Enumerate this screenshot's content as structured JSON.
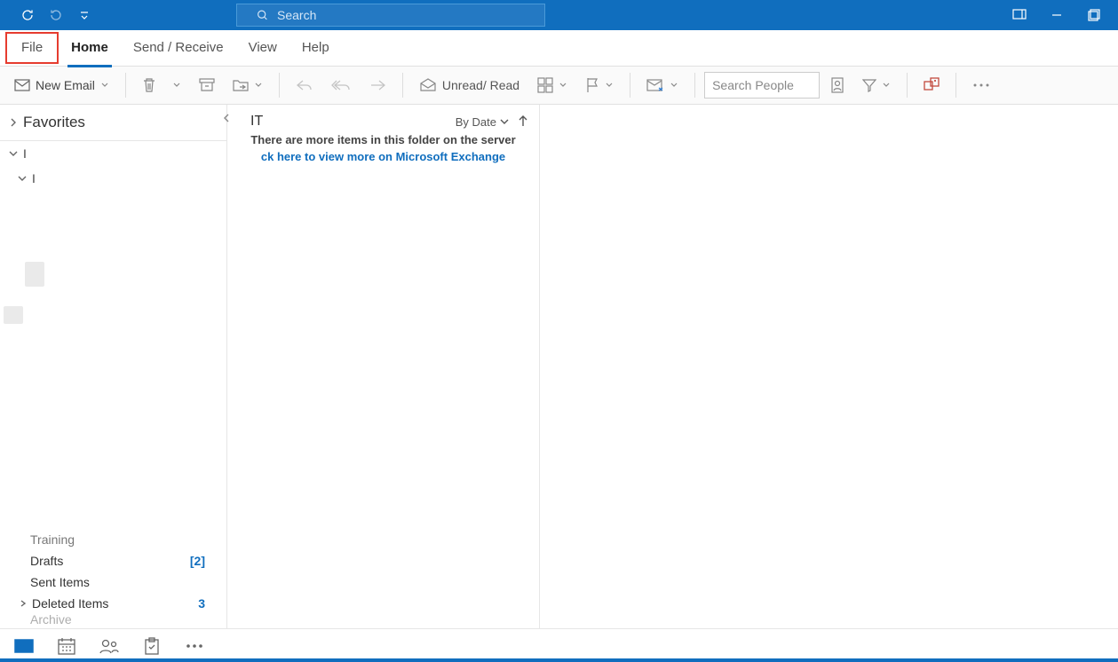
{
  "titlebar": {
    "search_placeholder": "Search"
  },
  "tabs": {
    "file": "File",
    "home": "Home",
    "send_receive": "Send / Receive",
    "view": "View",
    "help": "Help"
  },
  "ribbon": {
    "new_email": "New Email",
    "unread_read": "Unread/ Read",
    "search_people_placeholder": "Search People"
  },
  "nav": {
    "favorites": "Favorites",
    "stub1": "I",
    "stub2": "I",
    "folders": {
      "training": "Training",
      "drafts": "Drafts",
      "drafts_count": "[2]",
      "sent": "Sent Items",
      "deleted": "Deleted Items",
      "deleted_count": "3",
      "archive": "Archive"
    }
  },
  "list": {
    "folder_name": "IT",
    "sort_label": "By Date",
    "server_notice": "There are more items in this folder on the server",
    "server_link": "ck here to view more on Microsoft Exchange"
  }
}
